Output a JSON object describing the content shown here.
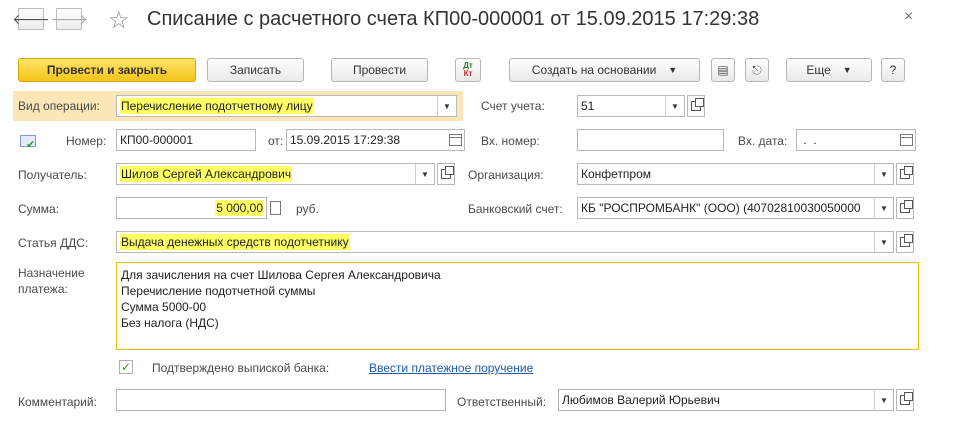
{
  "window": {
    "title": "Списание с расчетного счета КП00-000001 от 15.09.2015 17:29:38"
  },
  "toolbar": {
    "post_close": "Провести и закрыть",
    "save": "Записать",
    "post": "Провести",
    "dtkt_top": "Дт",
    "dtkt_bottom": "Кт",
    "create_based_on": "Создать на основании",
    "more": "Еще",
    "help": "?"
  },
  "form": {
    "operation_type": {
      "label": "Вид операции:",
      "value": "Перечисление подотчетному лицу"
    },
    "account": {
      "label": "Счет учета:",
      "value": "51"
    },
    "number": {
      "label": "Номер:",
      "value": "КП00-000001"
    },
    "date": {
      "label": "от:",
      "value": "15.09.2015 17:29:38"
    },
    "incoming_number": {
      "label": "Вх. номер:",
      "value": ""
    },
    "incoming_date": {
      "label": "Вх. дата:",
      "value": " .  .    "
    },
    "recipient": {
      "label": "Получатель:",
      "value": "Шилов Сергей Александрович"
    },
    "organization": {
      "label": "Организация:",
      "value": "Конфетпром"
    },
    "amount": {
      "label": "Сумма:",
      "value": "5 000,00",
      "currency": "руб."
    },
    "bank_account": {
      "label": "Банковский счет:",
      "value": "КБ \"РОСПРОМБАНК\" (ООО) (40702810030050000"
    },
    "cash_flow_item": {
      "label": "Статья ДДС:",
      "value": "Выдача денежных средств подотчетнику"
    },
    "payment_purpose": {
      "label_line1": "Назначение",
      "label_line2": "платежа:",
      "lines": [
        "Для зачисления на счет Шилова Сергея Александровича",
        "Перечисление подотчетной суммы",
        "Сумма 5000-00",
        "Без налога (НДС)"
      ]
    },
    "confirmed": {
      "label": "Подтверждено выпиской банка:",
      "checked": true
    },
    "payment_order_link": "Ввести платежное поручение",
    "comment": {
      "label": "Комментарий:",
      "value": ""
    },
    "responsible": {
      "label": "Ответственный:",
      "value": "Любимов Валерий Юрьевич"
    }
  },
  "colors": {
    "highlight": "#ffff66",
    "primary_button": "#f5c518",
    "link": "#1f5aa8",
    "checkmark": "#2e9b2e"
  }
}
